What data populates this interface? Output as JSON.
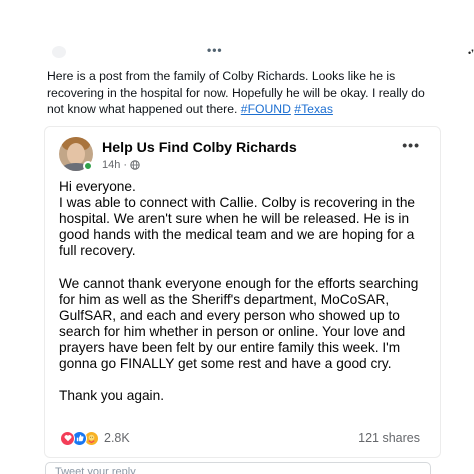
{
  "top": {
    "more_dots": "•••",
    "corner_mark": "•❜"
  },
  "tweet": {
    "text_before": "Here is a post from the family of Colby Richards. Looks like he is recovering in the hospital for now. Hopefully he will be okay. I really do not know what happened out there. ",
    "hashtags": [
      "#FOUND",
      "#Texas"
    ]
  },
  "embedded_post": {
    "page_name": "Help Us Find Colby Richards",
    "timestamp": "14h",
    "separator": "·",
    "audience_icon": "globe-icon",
    "more_dots": "•••",
    "body": "Hi everyone.\nI was able to connect with Callie. Colby is recovering in the hospital. We aren't sure when he will be released. He is in good hands with the medical team and we are hoping for a full recovery.\n\nWe cannot thank everyone enough for the efforts searching for him as well as the Sheriff's department, MoCoSAR, GulfSAR, and each and every person who showed up to search for him whether in person or online. Your love and prayers have been felt by our entire family this week. I'm gonna go FINALLY get some rest and have a good cry.\n\nThank you again.",
    "reaction_icons": [
      "love-icon",
      "like-icon",
      "care-icon"
    ],
    "reaction_count": "2.8K",
    "shares": "121 shares"
  },
  "reply": {
    "placeholder": "Tweet your reply"
  },
  "colors": {
    "link": "#1d6fd1",
    "online": "#31a24c",
    "love": "#f33e58",
    "like": "#1877f2",
    "care": "#f7b125"
  }
}
